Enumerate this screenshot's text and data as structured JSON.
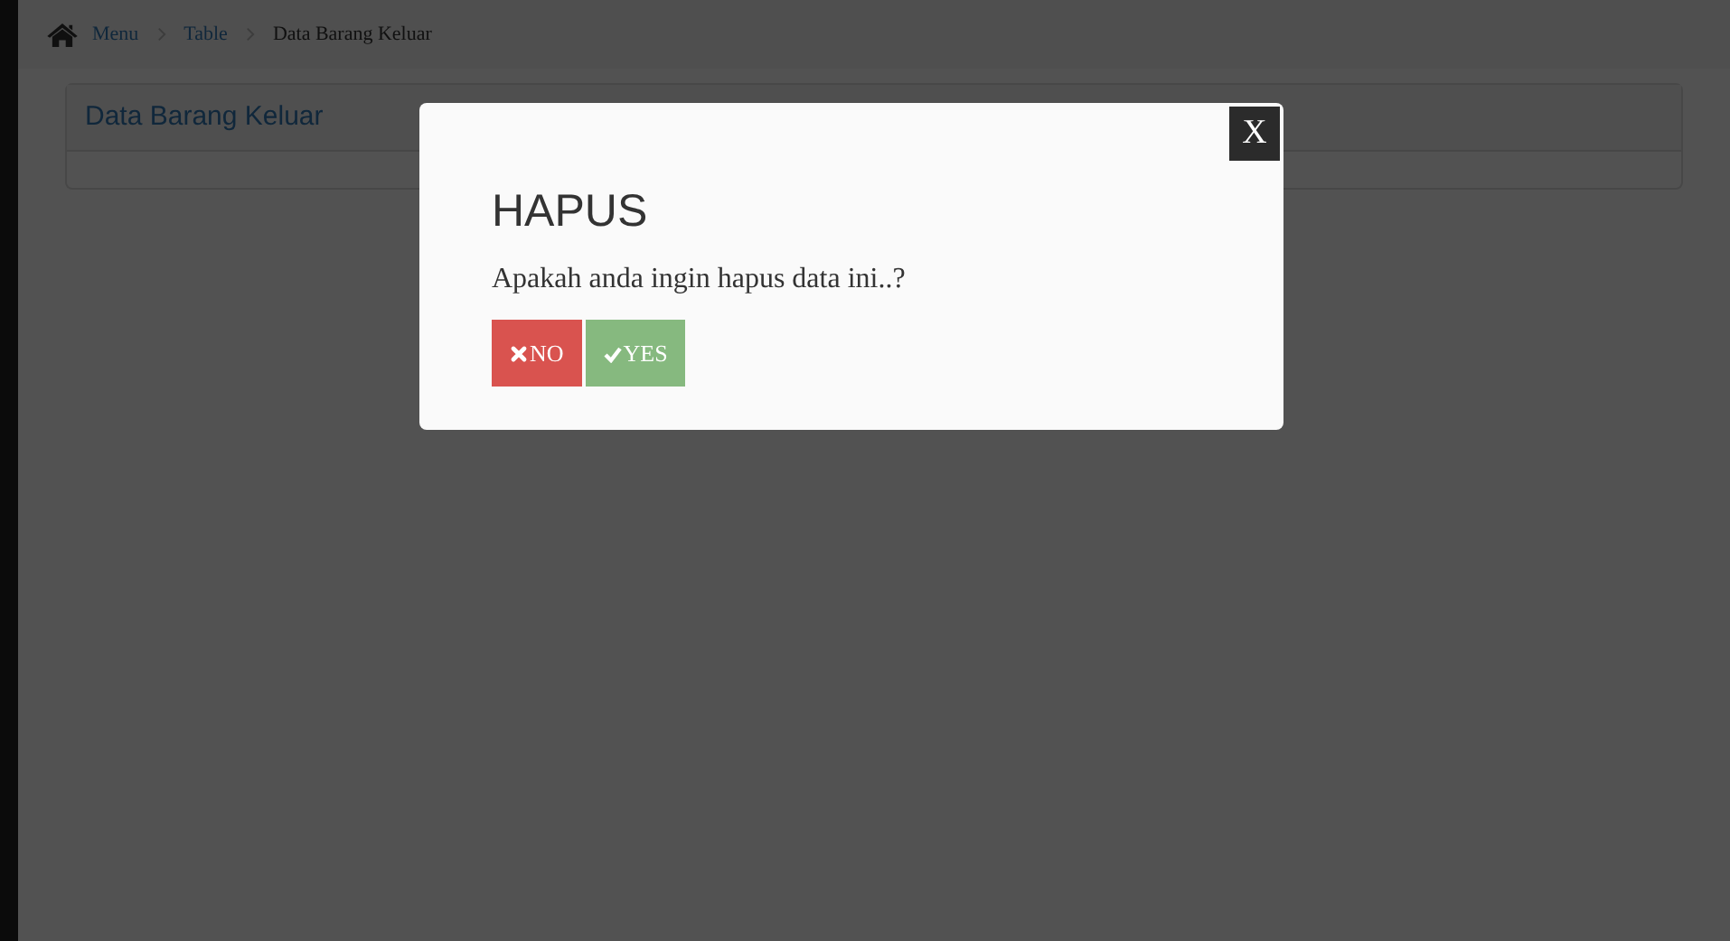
{
  "breadcrumb": [
    {
      "label": "Menu",
      "kind": "link"
    },
    {
      "label": "Table",
      "kind": "link"
    },
    {
      "label": "Data Barang Keluar",
      "kind": "current"
    }
  ],
  "panel": {
    "title": "Data Barang Keluar"
  },
  "dialog": {
    "close": "X",
    "title": "HAPUS",
    "message": "Apakah anda ingin hapus data ini..?",
    "buttons": [
      {
        "label": "NO",
        "kind": "danger"
      },
      {
        "label": "YES",
        "kind": "success"
      }
    ]
  }
}
